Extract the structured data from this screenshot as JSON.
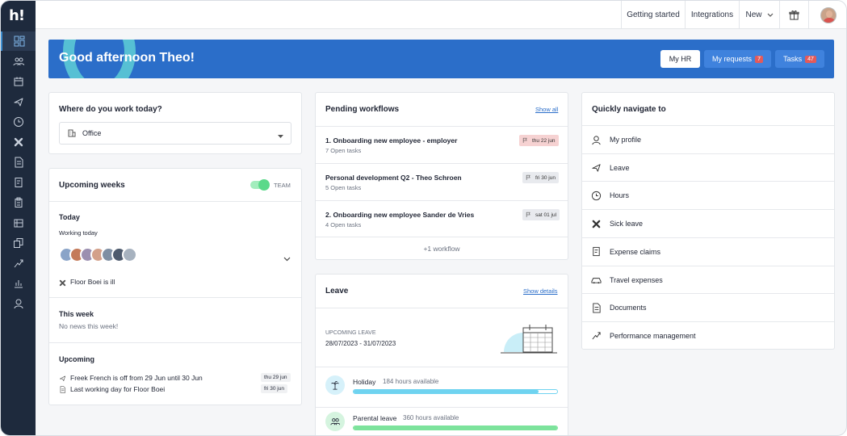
{
  "app": {
    "logo": "h!"
  },
  "sidebar": {
    "items": [
      {
        "icon": "dashboard-icon",
        "active": true
      },
      {
        "icon": "people-icon"
      },
      {
        "icon": "calendar-icon"
      },
      {
        "icon": "plane-icon"
      },
      {
        "icon": "clock-icon"
      },
      {
        "icon": "bandage-icon"
      },
      {
        "icon": "document-icon"
      },
      {
        "icon": "receipt-icon"
      },
      {
        "icon": "clipboard-icon"
      },
      {
        "icon": "reports-icon"
      },
      {
        "icon": "copy-icon"
      },
      {
        "icon": "performance-icon"
      },
      {
        "icon": "chart-icon"
      },
      {
        "icon": "user-icon"
      }
    ]
  },
  "topbar": {
    "getting_started": "Getting started",
    "integrations": "Integrations",
    "new": "New",
    "gift_icon": "gift-icon"
  },
  "banner": {
    "greeting": "Good afternoon Theo!",
    "my_hr": "My HR",
    "my_requests": "My requests",
    "my_requests_count": "7",
    "tasks": "Tasks",
    "tasks_count": "47"
  },
  "work_location": {
    "title": "Where do you work today?",
    "selected": "Office"
  },
  "upcoming_weeks": {
    "title": "Upcoming weeks",
    "toggle_label": "TEAM",
    "today_heading": "Today",
    "working_today": "Working today",
    "ill_note": "Floor Boei is ill",
    "this_week_heading": "This week",
    "this_week_text": "No news this week!",
    "upcoming_heading": "Upcoming",
    "upcoming_items": [
      {
        "text": "Freek French is off from 29 Jun until 30 Jun",
        "date": "thu 29 jun",
        "icon": "plane-icon"
      },
      {
        "text": "Last working day for Floor Boei",
        "date": "fri 30 jun",
        "icon": "document-icon"
      }
    ]
  },
  "workflows": {
    "title": "Pending workflows",
    "show_all": "Show all",
    "items": [
      {
        "title": "1. Onboarding new employee - employer",
        "sub": "7 Open tasks",
        "date": "thu 22 jun",
        "overdue": true
      },
      {
        "title": "Personal development Q2 - Theo Schroen",
        "sub": "5 Open tasks",
        "date": "fri 30 jun",
        "overdue": false
      },
      {
        "title": "2. Onboarding new employee Sander de Vries",
        "sub": "4 Open tasks",
        "date": "sat 01 jul",
        "overdue": false
      }
    ],
    "more": "+1 workflow"
  },
  "leave": {
    "title": "Leave",
    "show_details": "Show details",
    "upcoming_label": "UPCOMING LEAVE",
    "upcoming_range": "28/07/2023 - 31/07/2023",
    "types": [
      {
        "name": "Holiday",
        "available": "184 hours available",
        "fill": 0.91,
        "color": "#6fd3f0",
        "icon": "palm-tree-icon"
      },
      {
        "name": "Parental leave",
        "available": "360 hours available",
        "fill": 1.0,
        "color": "#7de39c",
        "icon": "people-icon"
      }
    ]
  },
  "quick_nav": {
    "title": "Quickly navigate to",
    "items": [
      {
        "label": "My profile",
        "icon": "user-icon"
      },
      {
        "label": "Leave",
        "icon": "plane-icon"
      },
      {
        "label": "Hours",
        "icon": "clock-icon"
      },
      {
        "label": "Sick leave",
        "icon": "bandage-icon"
      },
      {
        "label": "Expense claims",
        "icon": "receipt-icon"
      },
      {
        "label": "Travel expenses",
        "icon": "car-icon"
      },
      {
        "label": "Documents",
        "icon": "document-icon"
      },
      {
        "label": "Performance management",
        "icon": "performance-icon"
      }
    ]
  },
  "colors": {
    "sidebar": "#1e2a3d",
    "banner": "#2b6ec9",
    "accent_teal": "#5ecfd6",
    "badge": "#e35a5a"
  }
}
